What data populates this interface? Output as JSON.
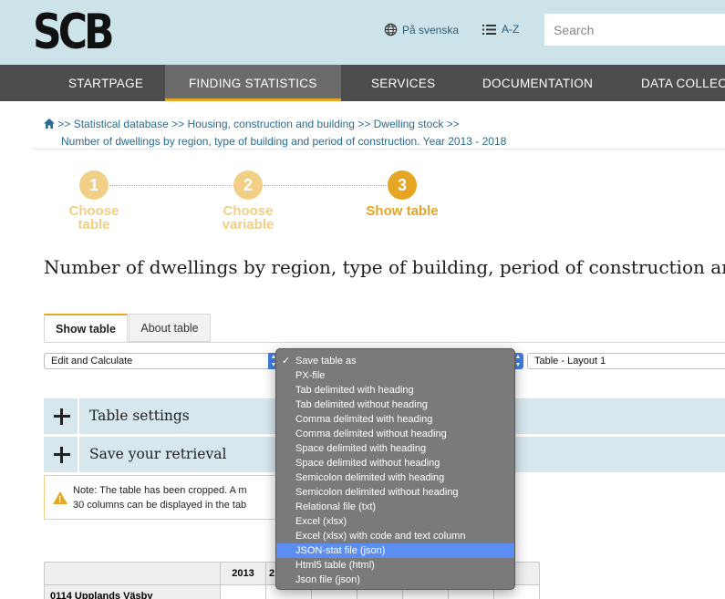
{
  "header": {
    "logo_text": "SCB",
    "language_link": "På svenska",
    "az_link": "A-Z",
    "search_placeholder": "Search"
  },
  "nav": {
    "items": [
      {
        "label": "STARTPAGE",
        "active": false
      },
      {
        "label": "FINDING STATISTICS",
        "active": true
      },
      {
        "label": "SERVICES",
        "active": false
      },
      {
        "label": "DOCUMENTATION",
        "active": false
      },
      {
        "label": "DATA COLLEC",
        "active": false
      }
    ]
  },
  "breadcrumb": {
    "sep": ">>",
    "items": [
      "Statistical database",
      "Housing, construction and building",
      "Dwelling stock"
    ],
    "current": "Number of dwellings by region, type of building and period of construction. Year 2013 - 2018"
  },
  "steps": [
    {
      "number": "1",
      "line1": "Choose",
      "line2": "table",
      "state": "done"
    },
    {
      "number": "2",
      "line1": "Choose",
      "line2": "variable",
      "state": "done"
    },
    {
      "number": "3",
      "line1": "Show table",
      "line2": "",
      "state": "current"
    }
  ],
  "page_title": "Number of dwellings by region, type of building, period of construction and",
  "tabs": {
    "show_table": "Show table",
    "about_table": "About table"
  },
  "selects": {
    "edit": "Edit and Calculate",
    "layout": "Table - Layout 1"
  },
  "accordion": {
    "table_settings": "Table settings",
    "save_retrieval": "Save your retrieval"
  },
  "note": {
    "line1": "Note: The table has been cropped. A m",
    "line2": "30 columns can be displayed in the tab"
  },
  "table": {
    "year_header": "2013",
    "next_header": "2",
    "row_label": "0114 Upplands Väsby"
  },
  "dropdown": {
    "options": [
      {
        "label": "Save table as",
        "selected": true,
        "highlight": false
      },
      {
        "label": "PX-file",
        "selected": false,
        "highlight": false
      },
      {
        "label": "Tab delimited with heading",
        "selected": false,
        "highlight": false
      },
      {
        "label": "Tab delimited without heading",
        "selected": false,
        "highlight": false
      },
      {
        "label": "Comma delimited with heading",
        "selected": false,
        "highlight": false
      },
      {
        "label": "Comma delimited without heading",
        "selected": false,
        "highlight": false
      },
      {
        "label": "Space delimited with heading",
        "selected": false,
        "highlight": false
      },
      {
        "label": "Space delimited without heading",
        "selected": false,
        "highlight": false
      },
      {
        "label": "Semicolon delimited with heading",
        "selected": false,
        "highlight": false
      },
      {
        "label": "Semicolon delimited without heading",
        "selected": false,
        "highlight": false
      },
      {
        "label": "Relational file (txt)",
        "selected": false,
        "highlight": false
      },
      {
        "label": "Excel (xlsx)",
        "selected": false,
        "highlight": false
      },
      {
        "label": "Excel (xlsx) with code and text column",
        "selected": false,
        "highlight": false
      },
      {
        "label": "JSON-stat file (json)",
        "selected": false,
        "highlight": true
      },
      {
        "label": "Html5 table (html)",
        "selected": false,
        "highlight": false
      },
      {
        "label": "Json file (json)",
        "selected": false,
        "highlight": false
      }
    ]
  },
  "colors": {
    "accent": "#e6a523",
    "nav_bg": "#4d4d4d",
    "header_bg": "#cde3ea",
    "highlight": "#5b8ef0"
  }
}
